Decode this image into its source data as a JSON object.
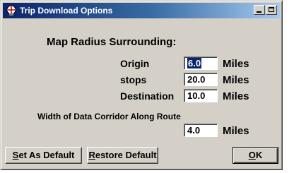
{
  "window": {
    "title": "Trip Download Options"
  },
  "labels": {
    "map_radius": "Map Radius Surrounding:",
    "origin": "Origin",
    "stops": "stops",
    "destination": "Destination",
    "corridor": "Width of Data Corridor Along Route"
  },
  "fields": {
    "origin": "6.0",
    "stops": "20.0",
    "destination": "10.0",
    "corridor": "4.0"
  },
  "unit": "Miles",
  "buttons": {
    "set_default": {
      "mnemonic": "S",
      "rest": "et As Default"
    },
    "restore_default": {
      "mnemonic": "R",
      "rest": "estore Default"
    },
    "ok": {
      "mnemonic": "O",
      "rest": "K"
    }
  },
  "colors": {
    "title_start": "#0a246a",
    "title_end": "#a6caf0",
    "face": "#d4d0c8"
  }
}
